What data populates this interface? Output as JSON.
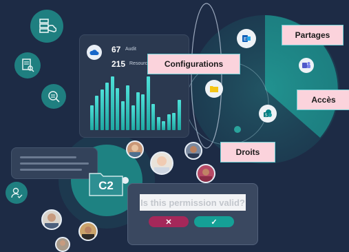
{
  "stats": {
    "audit_value": "67",
    "audit_label": "Audit",
    "resources_value": "215",
    "resources_label": "Resources"
  },
  "chart_data": {
    "type": "bar",
    "values": [
      38,
      52,
      62,
      72,
      82,
      64,
      44,
      68,
      38,
      58,
      54,
      82,
      40,
      20,
      14,
      24,
      26,
      46
    ]
  },
  "tags": {
    "configurations": "Configurations",
    "partages": "Partages",
    "acces": "Accès",
    "droits": "Droits"
  },
  "folder": {
    "label": "C2"
  },
  "permission_dialog": {
    "question": "Is this permission valid?",
    "reject_symbol": "✕",
    "approve_symbol": "✓"
  },
  "colors": {
    "background": "#1d2b45",
    "teal": "#1f8f8c",
    "reject": "#a5285a",
    "approve": "#15a096",
    "tag_fill": "#fbd3dc"
  }
}
